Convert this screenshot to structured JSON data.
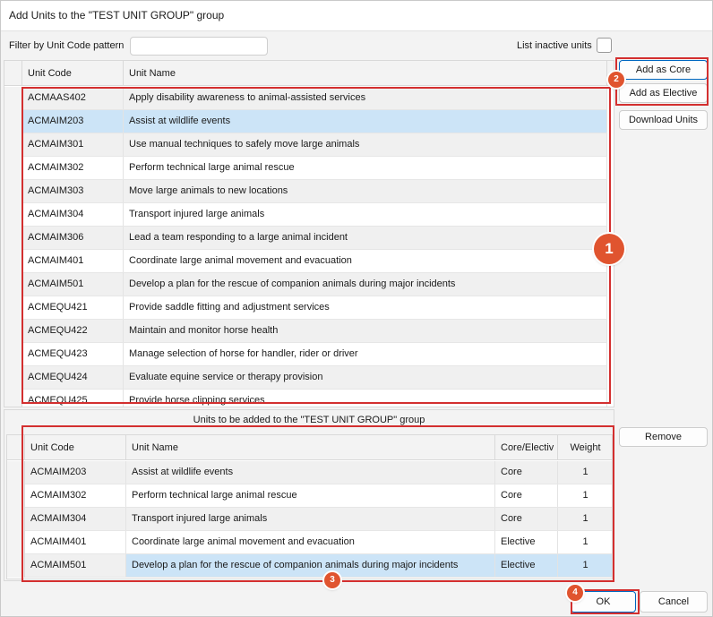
{
  "window": {
    "title": "Add Units to the \"TEST UNIT GROUP\" group"
  },
  "filter": {
    "label": "Filter by Unit Code pattern",
    "value": ""
  },
  "inactive": {
    "label": "List inactive units",
    "checked": false
  },
  "available": {
    "headers": {
      "code": "Unit Code",
      "name": "Unit Name"
    },
    "rows": [
      {
        "code": "ACMAAS402",
        "name": "Apply disability awareness to animal-assisted services"
      },
      {
        "code": "ACMAIM203",
        "name": "Assist at wildlife events",
        "selected": true
      },
      {
        "code": "ACMAIM301",
        "name": "Use manual techniques to safely move large animals"
      },
      {
        "code": "ACMAIM302",
        "name": "Perform technical large animal rescue"
      },
      {
        "code": "ACMAIM303",
        "name": "Move large animals to new locations"
      },
      {
        "code": "ACMAIM304",
        "name": "Transport injured large animals"
      },
      {
        "code": "ACMAIM306",
        "name": "Lead a team responding to a large animal incident"
      },
      {
        "code": "ACMAIM401",
        "name": "Coordinate large animal movement and evacuation"
      },
      {
        "code": "ACMAIM501",
        "name": "Develop a plan for the rescue of companion animals during major incidents"
      },
      {
        "code": "ACMEQU421",
        "name": "Provide saddle fitting and adjustment services"
      },
      {
        "code": "ACMEQU422",
        "name": "Maintain and monitor horse health"
      },
      {
        "code": "ACMEQU423",
        "name": "Manage selection of horse for handler, rider or driver"
      },
      {
        "code": "ACMEQU424",
        "name": "Evaluate equine service or therapy provision"
      },
      {
        "code": "ACMEQU425",
        "name": "Provide horse clipping services"
      }
    ]
  },
  "buttons": {
    "add_core": "Add as Core",
    "add_elective": "Add as Elective",
    "download": "Download Units",
    "remove": "Remove",
    "ok": "OK",
    "cancel": "Cancel"
  },
  "to_add": {
    "title": "Units to be added to the \"TEST UNIT GROUP\" group",
    "headers": {
      "code": "Unit Code",
      "name": "Unit Name",
      "type": "Core/Electiv",
      "weight": "Weight"
    },
    "rows": [
      {
        "code": "ACMAIM203",
        "name": "Assist at wildlife events",
        "type": "Core",
        "weight": "1"
      },
      {
        "code": "ACMAIM302",
        "name": "Perform technical large animal rescue",
        "type": "Core",
        "weight": "1"
      },
      {
        "code": "ACMAIM304",
        "name": "Transport injured large animals",
        "type": "Core",
        "weight": "1"
      },
      {
        "code": "ACMAIM401",
        "name": "Coordinate large animal movement and evacuation",
        "type": "Elective",
        "weight": "1"
      },
      {
        "code": "ACMAIM501",
        "name": "Develop a plan for the rescue of companion animals during major incidents",
        "type": "Elective",
        "weight": "1",
        "selected": true
      }
    ]
  },
  "callouts": {
    "c1": "1",
    "c2": "2",
    "c3": "3",
    "c4": "4"
  },
  "colors": {
    "highlight": "#d32f2f",
    "badge": "#e0542f",
    "selection": "#cce4f7"
  }
}
